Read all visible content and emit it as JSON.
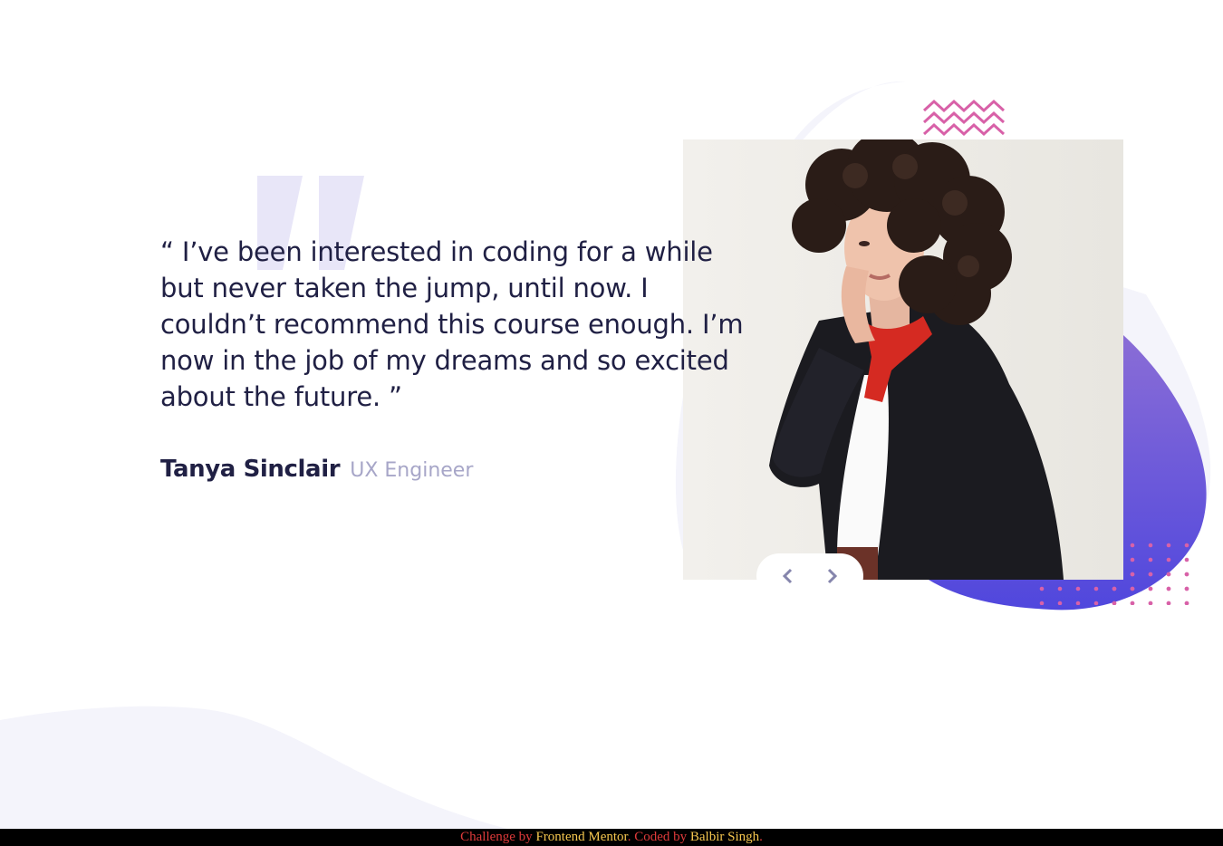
{
  "testimonial": {
    "quote": "“ I’ve been interested in coding for a while but never taken the jump, until now. I couldn’t recommend this course enough. I’m now in the job of my dreams and so excited about the future. ”",
    "author_name": "Tanya Sinclair",
    "author_role": "UX Engineer"
  },
  "navigation": {
    "prev_icon": "chevron-left-icon",
    "next_icon": "chevron-right-icon"
  },
  "footer": {
    "prefix": "Challenge by ",
    "link1": "Frontend Mentor",
    "middle": ". Coded by ",
    "link2": "Balbir Singh",
    "suffix": "."
  },
  "colors": {
    "dark_navy": "#202044",
    "grayish_blue": "#a7a6c8",
    "blob_start": "#8a6dd6",
    "blob_end": "#5047dd",
    "accent_pink": "#d861a8",
    "light_bg": "#f4f4fb",
    "footer_text": "#e03b3b",
    "footer_link": "#f6c74f"
  }
}
